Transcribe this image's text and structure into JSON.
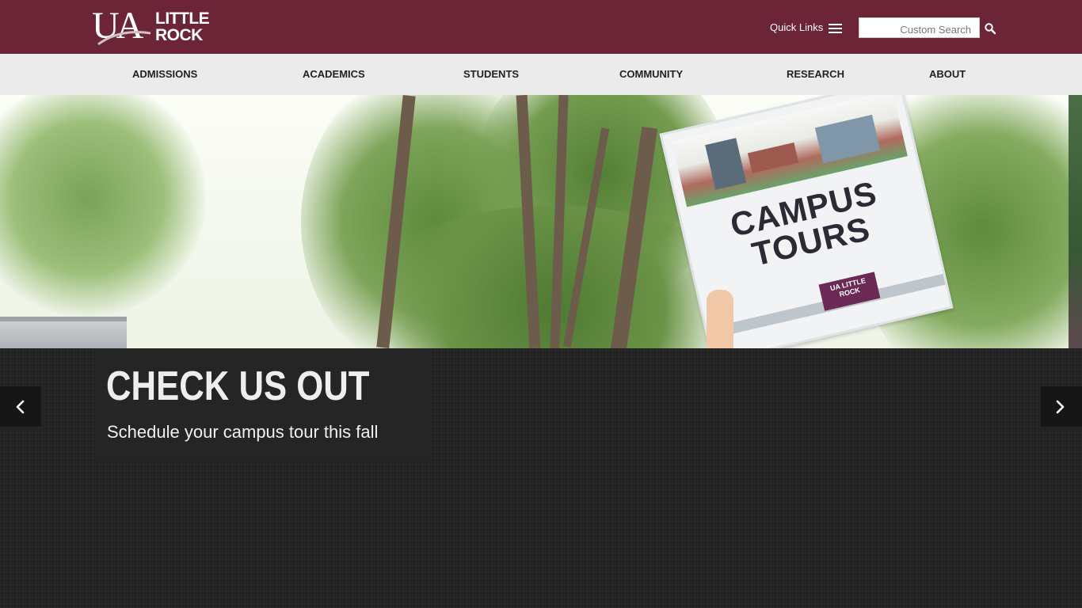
{
  "header": {
    "logo": {
      "mark": "UA",
      "line1": "LITTLE",
      "line2": "ROCK"
    },
    "quick_links_label": "Quick Links",
    "search": {
      "placeholder": "Custom Search"
    }
  },
  "nav": {
    "items": [
      {
        "label": "ADMISSIONS"
      },
      {
        "label": "ACADEMICS"
      },
      {
        "label": "STUDENTS"
      },
      {
        "label": "COMMUNITY"
      },
      {
        "label": "RESEARCH"
      },
      {
        "label": "ABOUT"
      }
    ]
  },
  "slide": {
    "heading": "CHECK US OUT",
    "subtext": "Schedule your campus tour this fall",
    "sign_title_line1": "CAMPUS",
    "sign_title_line2": "TOURS",
    "sign_badge_line1": "UA LITTLE",
    "sign_badge_line2": "ROCK"
  },
  "colors": {
    "brand": "#6b2536",
    "nav_bg": "#ebebeb",
    "slide_panel": "#222222"
  },
  "icons": {
    "menu": "hamburger-icon",
    "search": "search-icon",
    "prev": "chevron-left-icon",
    "next": "chevron-right-icon"
  }
}
